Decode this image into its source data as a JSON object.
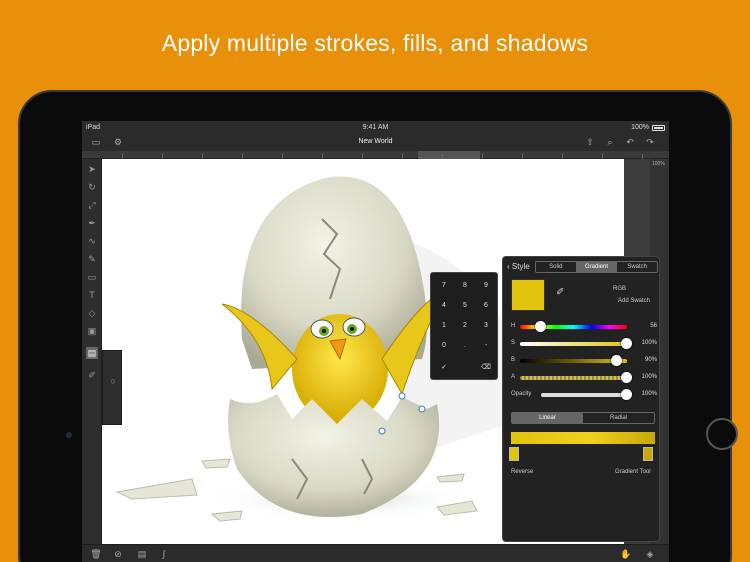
{
  "headline": "Apply multiple strokes, fills, and shadows",
  "status": {
    "device": "iPad",
    "time": "9:41 AM",
    "battery": "100%"
  },
  "document": {
    "title": "New World"
  },
  "zoom": "100%",
  "keypad": {
    "keys": [
      "7",
      "8",
      "9",
      "4",
      "5",
      "6",
      "1",
      "2",
      "3",
      "0",
      ".",
      "-"
    ],
    "confirm": "✓",
    "delete": "⌫"
  },
  "style_panel": {
    "back_label": "Style",
    "tabs": [
      "Solid",
      "Gradient",
      "Swatch"
    ],
    "active_tab": "Gradient",
    "color_model": "RGB",
    "add_swatch": "Add Swatch",
    "fill_color": "#E0C40E",
    "sliders": [
      {
        "label": "H",
        "value": "56",
        "position": 0.15
      },
      {
        "label": "S",
        "value": "100%",
        "position": 1.0
      },
      {
        "label": "B",
        "value": "90%",
        "position": 0.9
      },
      {
        "label": "A",
        "value": "100%",
        "position": 1.0
      },
      {
        "label": "Opacity",
        "value": "100%",
        "position": 1.0
      }
    ],
    "gradient_types": [
      "Linear",
      "Radial"
    ],
    "active_gradient": "Linear",
    "reverse_label": "Reverse",
    "gradient_tool_label": "Gradient Tool"
  },
  "colors": {
    "background": "#E8900A",
    "accent": "#E0C40E"
  }
}
